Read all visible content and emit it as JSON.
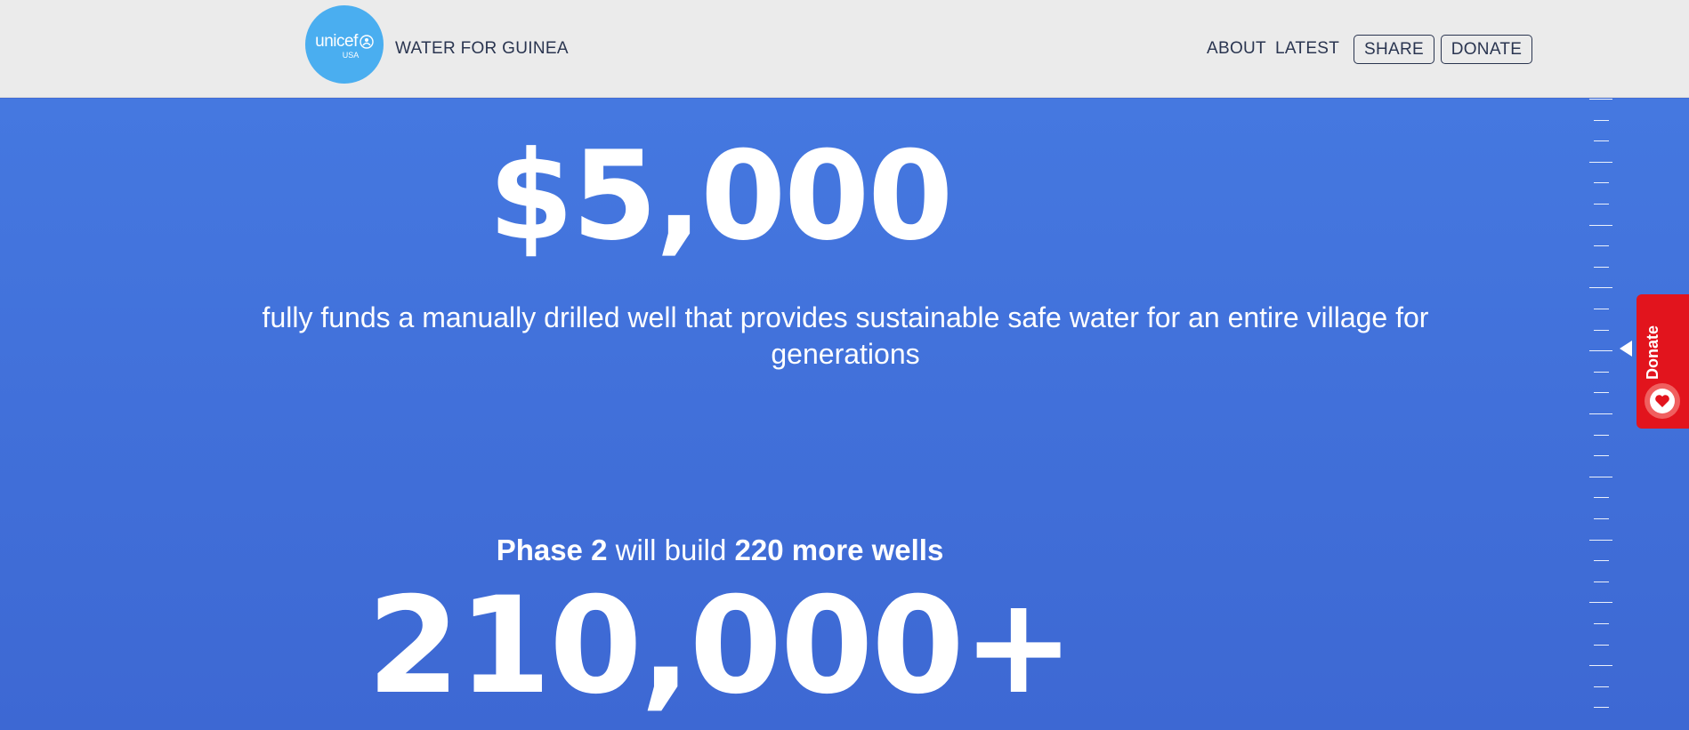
{
  "header": {
    "logo": {
      "brand": "unicef",
      "sub": "USA",
      "icon": "unicef-emblem-icon"
    },
    "site_title": "WATER FOR GUINEA",
    "nav": {
      "about": "ABOUT",
      "latest": "LATEST",
      "share": "SHARE",
      "donate": "DONATE"
    }
  },
  "hero": {
    "amount": "$5,000",
    "description": "fully funds a manually drilled well that provides sustainable safe water for an entire village for generations",
    "phase": {
      "part1": "Phase 2",
      "part2": " will build ",
      "part3": "220 more wells"
    },
    "count": "210,000+"
  },
  "donate_tab": {
    "label": "Donate",
    "icon": "heart-icon"
  },
  "colors": {
    "header_bg": "#ebebeb",
    "hero_bg": "#4070d8",
    "logo_bg": "#4aaef0",
    "donate_bg": "#e2141d",
    "nav_text": "#2a3550"
  }
}
